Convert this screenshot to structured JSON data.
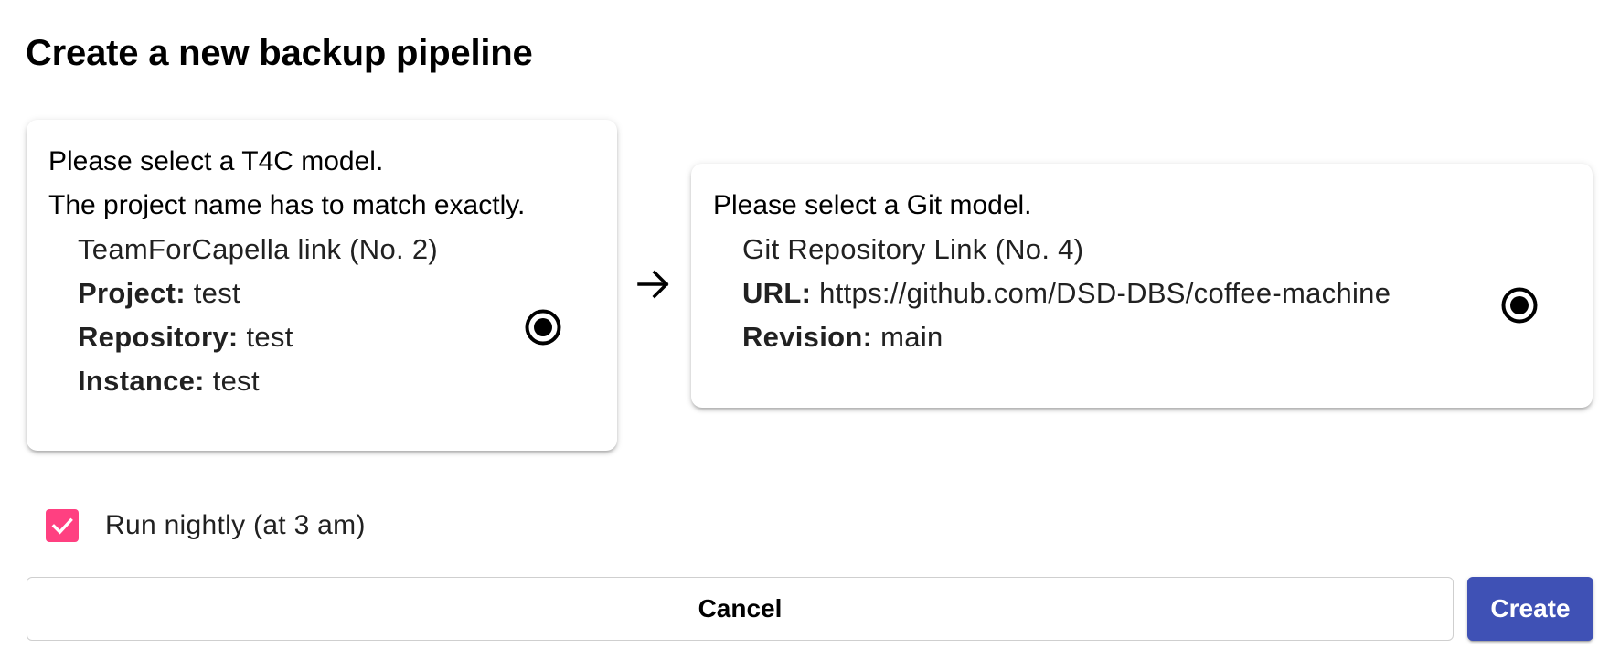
{
  "dialog": {
    "title": "Create a new backup pipeline"
  },
  "t4c_card": {
    "intro_line1": "Please select a T4C model.",
    "intro_line2": "The project name has to match exactly.",
    "option": {
      "title": "TeamForCapella link (No. 2)",
      "project_label": "Project:",
      "project_value": "test",
      "repository_label": "Repository:",
      "repository_value": "test",
      "instance_label": "Instance:",
      "instance_value": "test",
      "selected": true
    }
  },
  "connector": {
    "icon": "arrow-right-icon"
  },
  "git_card": {
    "intro_line1": "Please select a Git model.",
    "option": {
      "title": "Git Repository Link (No. 4)",
      "url_label": "URL:",
      "url_value": "https://github.com/DSD-DBS/coffee-machine",
      "revision_label": "Revision:",
      "revision_value": "main",
      "selected": true
    }
  },
  "schedule": {
    "checkbox_label": "Run nightly (at 3 am)",
    "checked": true
  },
  "actions": {
    "cancel_label": "Cancel",
    "create_label": "Create"
  },
  "colors": {
    "accent_checkbox": "#ff4081",
    "primary_button": "#3f51b5",
    "radio": "#000000"
  }
}
